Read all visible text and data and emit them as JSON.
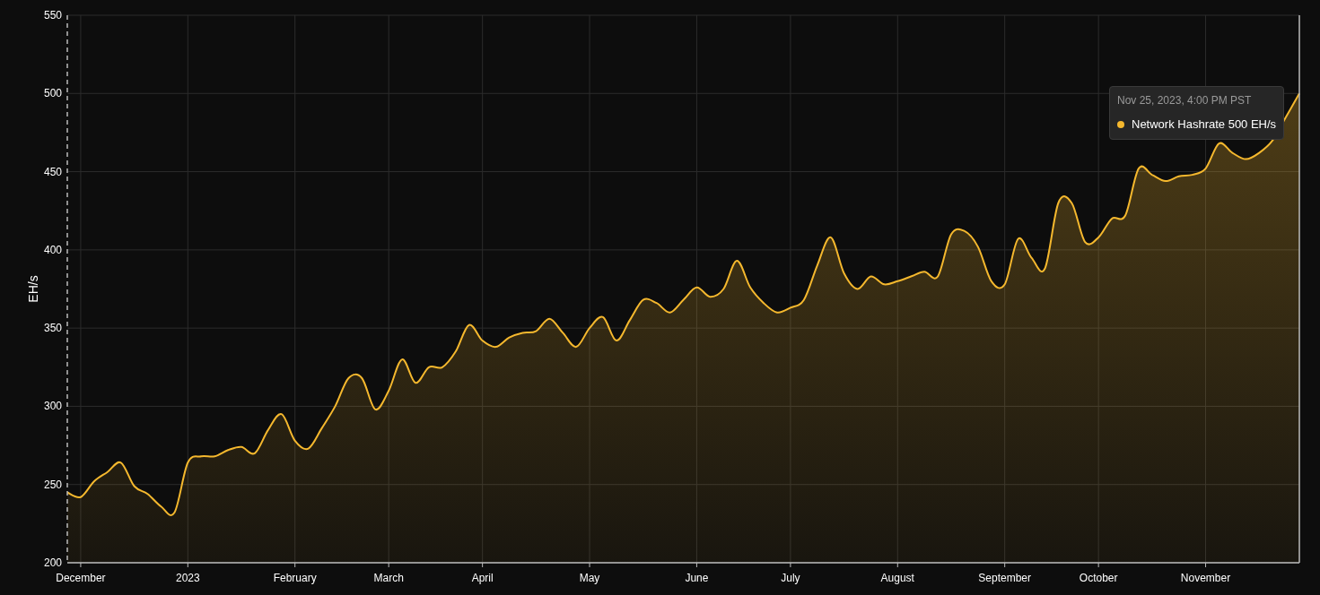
{
  "chart": {
    "chart_data": {
      "type": "area",
      "grid": true,
      "ylabel": "EH/s",
      "ylim": [
        200,
        550
      ],
      "yticks": [
        200,
        250,
        300,
        350,
        400,
        450,
        500,
        550
      ],
      "categories": [
        null,
        "December",
        null,
        null,
        null,
        null,
        null,
        null,
        null,
        "2023",
        null,
        null,
        null,
        null,
        null,
        null,
        null,
        "February",
        null,
        null,
        null,
        null,
        null,
        null,
        "March",
        null,
        null,
        null,
        null,
        null,
        null,
        "April",
        null,
        null,
        null,
        null,
        null,
        null,
        null,
        "May",
        null,
        null,
        null,
        null,
        null,
        null,
        null,
        "June",
        null,
        null,
        null,
        null,
        null,
        null,
        "July",
        null,
        null,
        null,
        null,
        null,
        null,
        null,
        "August",
        null,
        null,
        null,
        null,
        null,
        null,
        null,
        "September",
        null,
        null,
        null,
        null,
        null,
        null,
        "October",
        null,
        null,
        null,
        null,
        null,
        null,
        null,
        "November",
        null,
        null,
        null,
        null,
        null,
        null,
        null
      ],
      "series": [
        {
          "name": "Network Hashrate",
          "color": "#f5b82e",
          "values": [
            245,
            242,
            252,
            258,
            264,
            249,
            244,
            236,
            232,
            264,
            268,
            268,
            272,
            274,
            270,
            285,
            295,
            278,
            273,
            286,
            300,
            318,
            318,
            298,
            310,
            330,
            315,
            325,
            325,
            335,
            352,
            342,
            338,
            344,
            347,
            348,
            356,
            347,
            338,
            350,
            357,
            342,
            355,
            368,
            366,
            360,
            368,
            376,
            370,
            375,
            393,
            376,
            366,
            360,
            363,
            368,
            390,
            408,
            385,
            375,
            383,
            378,
            380,
            383,
            386,
            383,
            410,
            412,
            402,
            380,
            378,
            407,
            395,
            388,
            430,
            430,
            405,
            408,
            420,
            422,
            452,
            448,
            444,
            447,
            448,
            452,
            468,
            462,
            458,
            462,
            470,
            485,
            500
          ]
        }
      ]
    },
    "tooltip": {
      "title": "Nov 25, 2023, 4:00 PM PST",
      "value": "500 EH/s",
      "color": "#f5b82e"
    }
  }
}
